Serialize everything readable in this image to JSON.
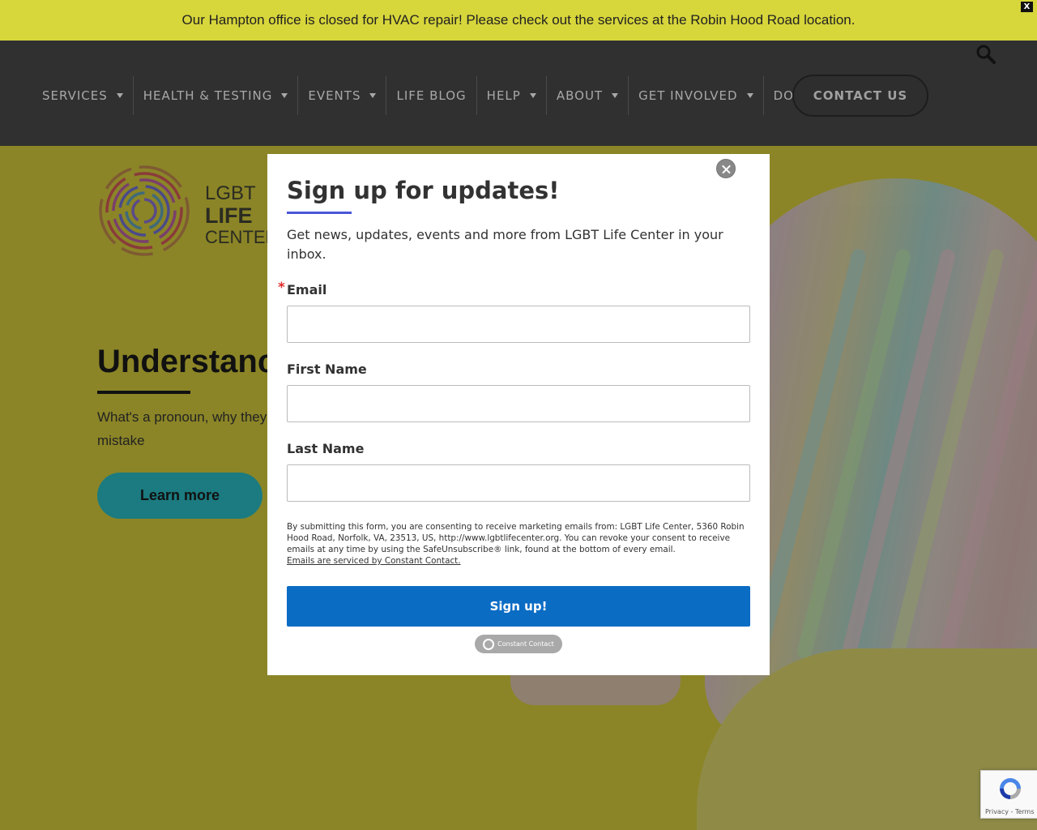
{
  "banner": {
    "text": "Our Hampton office is closed for HVAC repair! Please check out the services at the Robin Hood Road location.",
    "close_label": "X"
  },
  "header": {
    "nav": [
      {
        "label": "SERVICES",
        "has_dropdown": true
      },
      {
        "label": "HEALTH & TESTING",
        "has_dropdown": true
      },
      {
        "label": "EVENTS",
        "has_dropdown": true
      },
      {
        "label": "LIFE BLOG",
        "has_dropdown": false
      },
      {
        "label": "HELP",
        "has_dropdown": true
      },
      {
        "label": "ABOUT",
        "has_dropdown": true
      },
      {
        "label": "GET INVOLVED",
        "has_dropdown": true
      },
      {
        "label": "DONATE",
        "has_dropdown": false
      }
    ],
    "contact_label": "CONTACT US",
    "search_icon": "search-icon"
  },
  "hero": {
    "logo": {
      "line1": "LGBT",
      "line2": "LIFE",
      "line3": "CENTER"
    },
    "title": "Understanc",
    "description": "What's a pronoun, why they mistake",
    "button_label": "Learn more"
  },
  "modal": {
    "title": "Sign up for updates!",
    "description": "Get news, updates, events and more from LGBT Life Center in your inbox.",
    "fields": [
      {
        "label": "Email",
        "required": true,
        "value": ""
      },
      {
        "label": "First Name",
        "required": false,
        "value": ""
      },
      {
        "label": "Last Name",
        "required": false,
        "value": ""
      }
    ],
    "required_marker": "*",
    "consent_text": "By submitting this form, you are consenting to receive marketing emails from: LGBT Life Center, 5360 Robin Hood Road, Norfolk, VA, 23513, US, http://www.lgbtlifecenter.org. You can revoke your consent to receive emails at any time by using the SafeUnsubscribe® link, found at the bottom of every email.",
    "consent_link": "Emails are serviced by Constant Contact.",
    "submit_label": "Sign up!",
    "badge_text": "Constant Contact"
  },
  "recaptcha": {
    "privacy_label": "Privacy",
    "separator": " - ",
    "terms_label": "Terms"
  },
  "colors": {
    "banner": "#d7d63b",
    "header": "#303030",
    "hero_overlay": "#8b8527",
    "signup_button": "#0b6cc4",
    "title_accent": "#4a56d8",
    "required": "#e02d2d"
  }
}
